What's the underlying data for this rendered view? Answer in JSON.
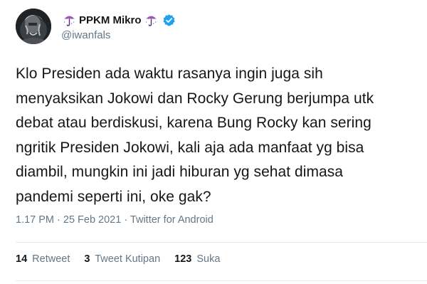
{
  "user": {
    "display_name": "PPKM Mikro",
    "handle": "@iwanfals",
    "leading_emoji": "umbrella-with-rain-icon",
    "trailing_emoji": "umbrella-with-rain-icon",
    "verified": true
  },
  "tweet": {
    "text": "Klo Presiden ada waktu rasanya ingin juga sih\nmenyaksikan Jokowi dan Rocky Gerung berjumpa utk\ndebat atau berdiskusi, karena Bung Rocky kan sering\nngritik Presiden Jokowi, kali aja ada manfaat yg bisa\ndiambil, mungkin ini jadi hiburan yg sehat dimasa\npandemi seperti ini, oke gak?",
    "timestamp": "1.17 PM · 25 Feb 2021 · Twitter for Android"
  },
  "stats": {
    "retweets": {
      "count": "14",
      "label": "Retweet"
    },
    "quotes": {
      "count": "3",
      "label": "Tweet Kutipan"
    },
    "likes": {
      "count": "123",
      "label": "Suka"
    }
  },
  "colors": {
    "text": "#14171a",
    "secondary": "#657786",
    "verified": "#1da1f2",
    "divider": "#e6ecf0",
    "emoji": "#9b59b6"
  }
}
